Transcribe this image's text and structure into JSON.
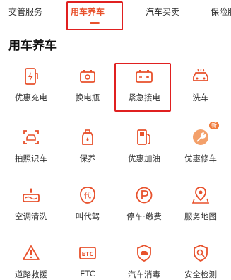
{
  "tabs": [
    {
      "label": "交管服务"
    },
    {
      "label": "用车养车",
      "active": true
    },
    {
      "label": "汽车买卖"
    },
    {
      "label": "保险服"
    }
  ],
  "section_title": "用车养车",
  "accent_color": "#e8512c",
  "highlight_color": "#e02020",
  "items": [
    {
      "label": "优惠充电",
      "icon": "charging-icon"
    },
    {
      "label": "换电瓶",
      "icon": "battery-swap-icon"
    },
    {
      "label": "紧急接电",
      "icon": "battery-jump-icon",
      "highlighted": true
    },
    {
      "label": "洗车",
      "icon": "car-wash-icon"
    },
    {
      "label": "拍照识车",
      "icon": "camera-car-icon"
    },
    {
      "label": "保养",
      "icon": "oil-bottle-icon"
    },
    {
      "label": "优惠加油",
      "icon": "fuel-pump-icon"
    },
    {
      "label": "优惠修车",
      "icon": "wrench-icon",
      "badge": "新"
    },
    {
      "label": "空调清洗",
      "icon": "ac-clean-icon"
    },
    {
      "label": "叫代驾",
      "icon": "designated-driver-icon"
    },
    {
      "label": "停车·缴费",
      "icon": "parking-icon"
    },
    {
      "label": "服务地图",
      "icon": "map-icon"
    },
    {
      "label": "道路救援",
      "icon": "road-rescue-icon"
    },
    {
      "label": "ETC",
      "icon": "etc-icon"
    },
    {
      "label": "汽车消毒",
      "icon": "car-disinfect-icon"
    },
    {
      "label": "安全检测",
      "icon": "safety-check-icon"
    }
  ]
}
